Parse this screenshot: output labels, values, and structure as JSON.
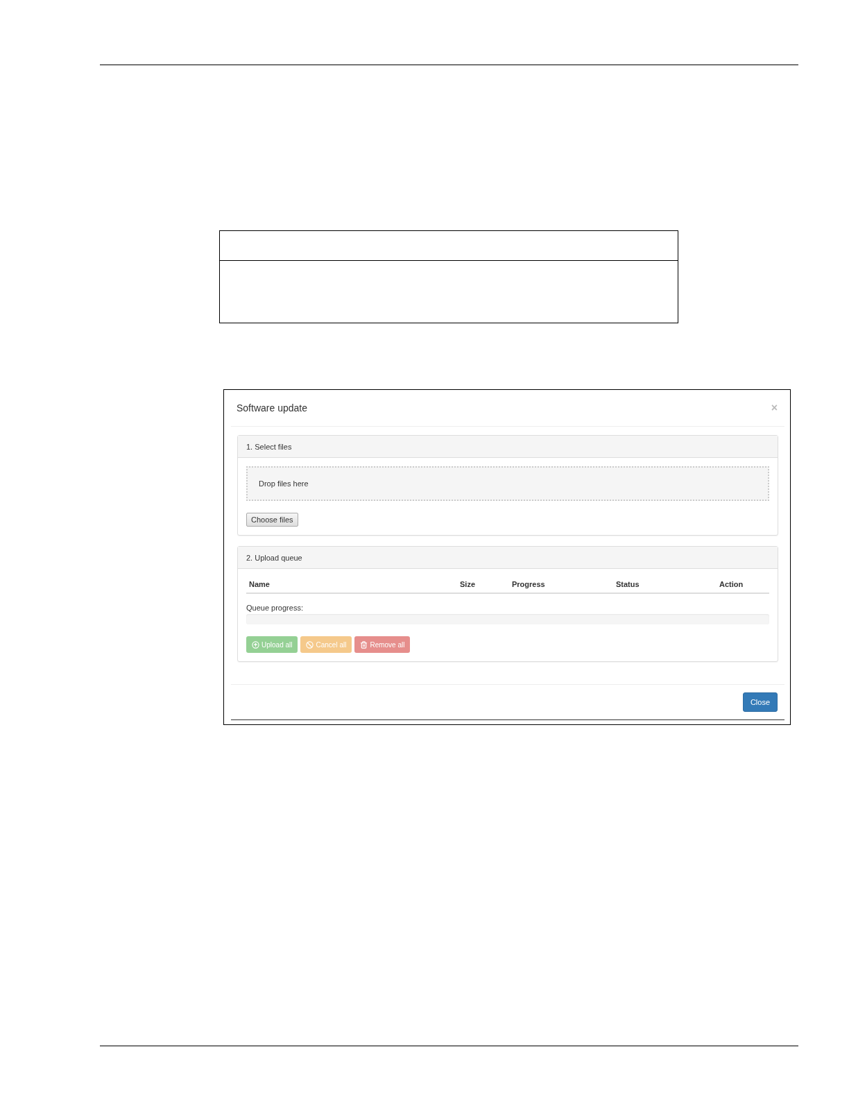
{
  "dialog": {
    "title": "Software update",
    "close_glyph": "×",
    "select_panel": {
      "title": "1. Select files",
      "dropzone": "Drop files here",
      "choose_button": "Choose files"
    },
    "queue_panel": {
      "title": "2. Upload queue",
      "columns": [
        "Name",
        "Size",
        "Progress",
        "Status",
        "Action"
      ],
      "progress_label": "Queue progress:",
      "progress": {
        "level": 0
      },
      "buttons": [
        {
          "kind": "upload",
          "label": "Upload all",
          "disabled": true
        },
        {
          "kind": "cancel",
          "label": "Cancel all",
          "disabled": true
        },
        {
          "kind": "remove",
          "label": "Remove all",
          "disabled": true
        }
      ]
    },
    "footer_button": "Close"
  }
}
